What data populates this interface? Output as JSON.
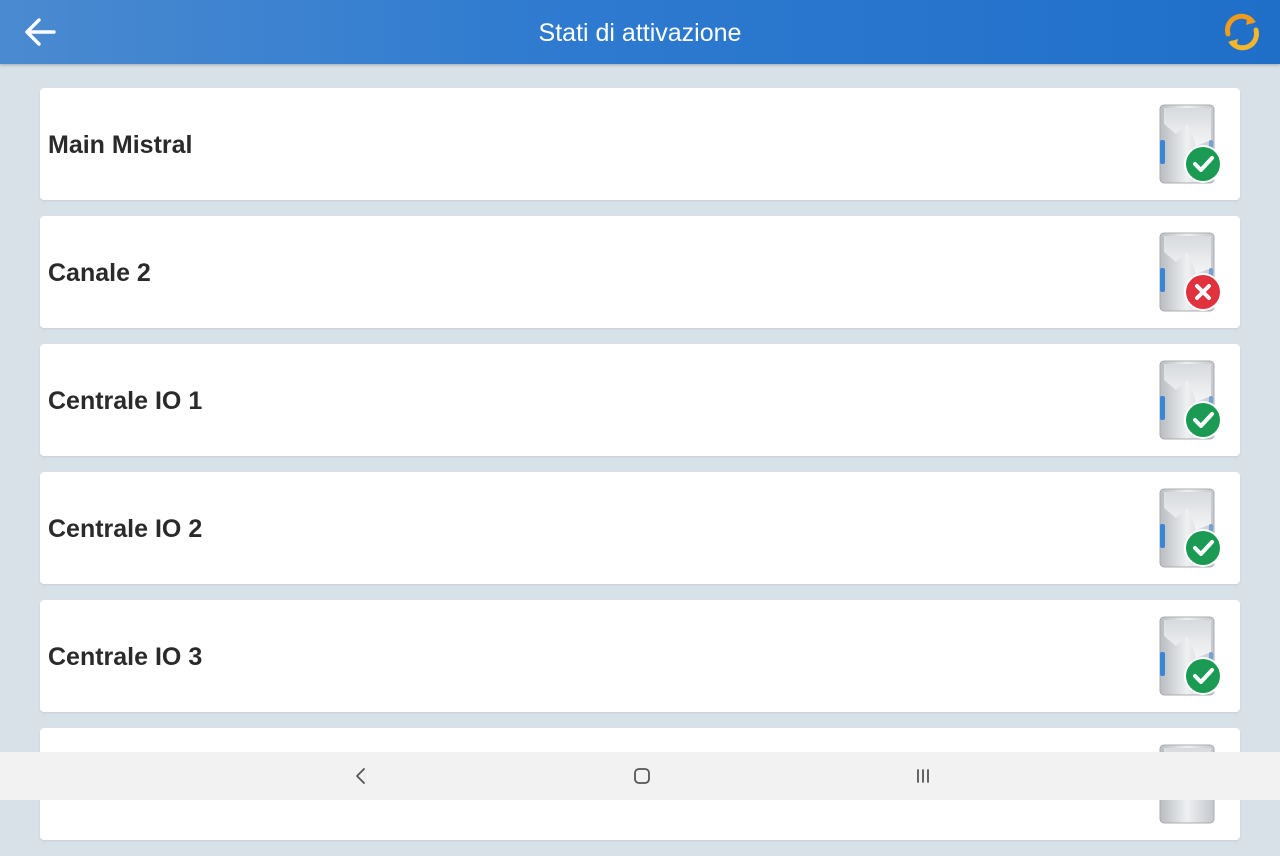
{
  "app_bar": {
    "title": "Stati di attivazione",
    "back_icon": "arrow-left-icon",
    "refresh_icon": "refresh-icon"
  },
  "devices": [
    {
      "name": "Main Mistral",
      "status": "active",
      "status_icon": "check-icon",
      "status_color": "#1a9a52"
    },
    {
      "name": "Canale 2",
      "status": "inactive",
      "status_icon": "cross-icon",
      "status_color": "#e0313d"
    },
    {
      "name": "Centrale IO 1",
      "status": "active",
      "status_icon": "check-icon",
      "status_color": "#1a9a52"
    },
    {
      "name": "Centrale IO 2",
      "status": "active",
      "status_icon": "check-icon",
      "status_color": "#1a9a52"
    },
    {
      "name": "Centrale IO 3",
      "status": "active",
      "status_icon": "check-icon",
      "status_color": "#1a9a52"
    },
    {
      "name": "",
      "status": "unknown",
      "status_icon": "",
      "status_color": ""
    }
  ],
  "nav_bar": {
    "back_icon": "nav-back-icon",
    "home_icon": "nav-home-icon",
    "recents_icon": "nav-recents-icon"
  },
  "colors": {
    "app_bar": "#2e7ad0",
    "background": "#d8e0e8",
    "active": "#1a9a52",
    "inactive": "#e0313d",
    "refresh_orange": "#f29a1a"
  }
}
